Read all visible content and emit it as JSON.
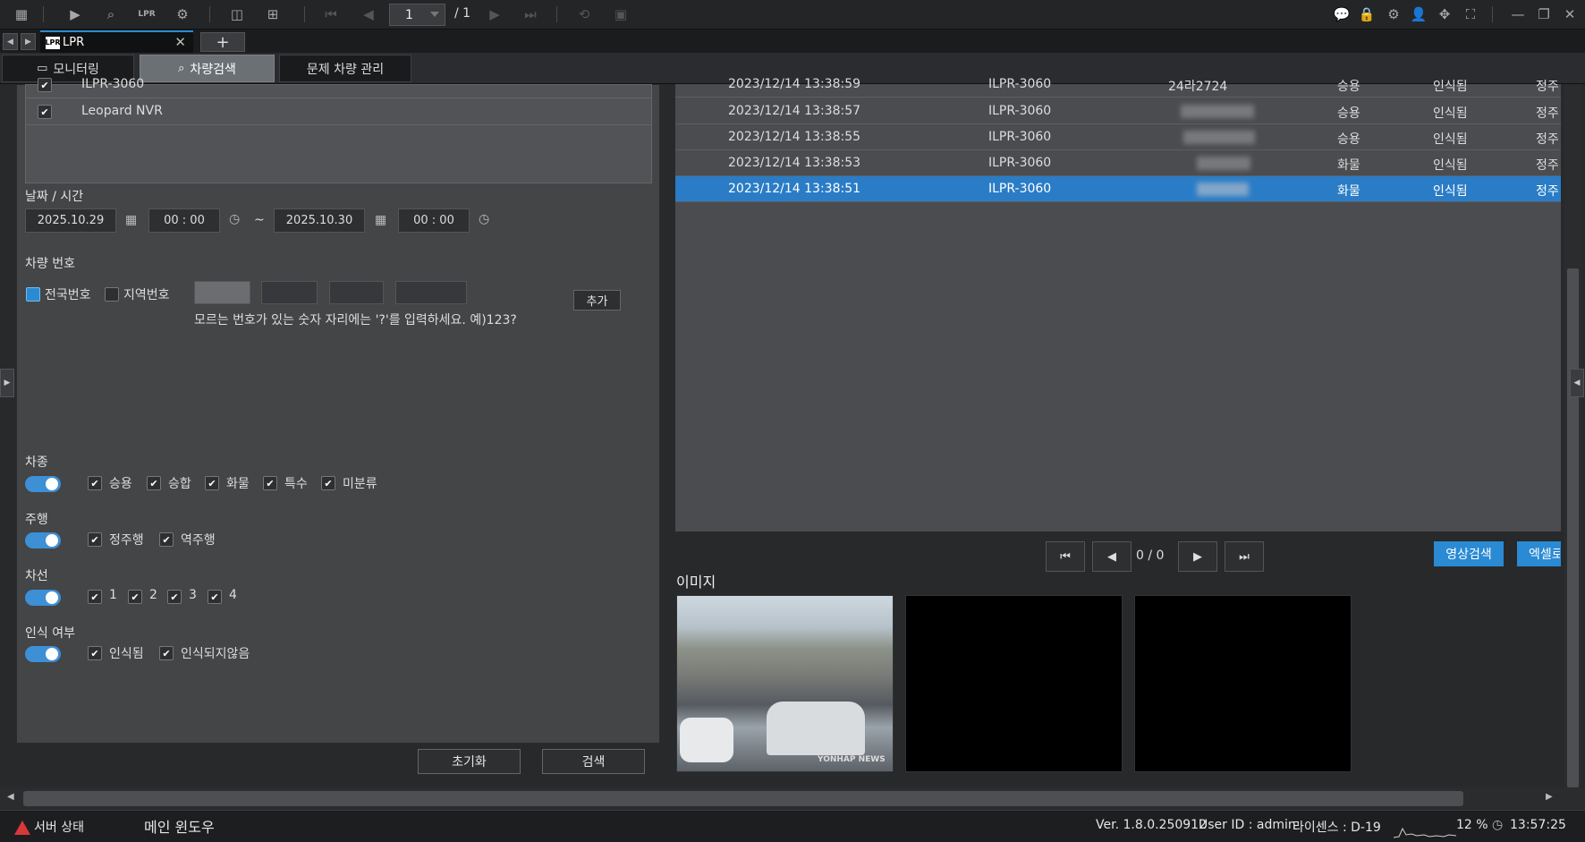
{
  "toolbar": {
    "page_current": "1",
    "page_total": "/ 1"
  },
  "tabs": {
    "main_tab_label": "LPR",
    "main_tab_logo": "LPR",
    "add_tab": "+"
  },
  "subtabs": [
    {
      "label": "모니터링",
      "active": false
    },
    {
      "label": "차량검색",
      "active": true
    },
    {
      "label": "문제 차량 관리",
      "active": false
    }
  ],
  "devices": [
    {
      "name": "ILPR-3060",
      "checked": true
    },
    {
      "name": "Leopard NVR",
      "checked": true
    }
  ],
  "datetime": {
    "label": "날짜 / 시간",
    "start_date": "2025.10.29",
    "start_time": "00 : 00",
    "separator": "~",
    "end_date": "2025.10.30",
    "end_time": "00 : 00"
  },
  "plate": {
    "label": "차량 번호",
    "national_label": "전국번호",
    "regional_label": "지역번호",
    "add_button": "추가",
    "hint": "모르는 번호가 있는 숫자 자리에는 '?'를 입력하세요. 예)123?"
  },
  "vehicle_type": {
    "label": "차종",
    "options": [
      "승용",
      "승합",
      "화물",
      "특수",
      "미분류"
    ]
  },
  "direction": {
    "label": "주행",
    "options": [
      "정주행",
      "역주행"
    ]
  },
  "lane": {
    "label": "차선",
    "options": [
      "1",
      "2",
      "3",
      "4"
    ]
  },
  "recognition": {
    "label": "인식 여부",
    "options": [
      "인식됨",
      "인식되지않음"
    ]
  },
  "actions": {
    "reset": "초기화",
    "search": "검색"
  },
  "results": [
    {
      "time": "2023/12/14 13:38:59",
      "device": "ILPR-3060",
      "plate": "24라2724",
      "type": "승용",
      "status": "인식됨",
      "dir": "정주"
    },
    {
      "time": "2023/12/14 13:38:57",
      "device": "ILPR-3060",
      "plate": "",
      "type": "승용",
      "status": "인식됨",
      "dir": "정주"
    },
    {
      "time": "2023/12/14 13:38:55",
      "device": "ILPR-3060",
      "plate": "",
      "type": "승용",
      "status": "인식됨",
      "dir": "정주"
    },
    {
      "time": "2023/12/14 13:38:53",
      "device": "ILPR-3060",
      "plate": "",
      "type": "화물",
      "status": "인식됨",
      "dir": "정주"
    },
    {
      "time": "2023/12/14 13:38:51",
      "device": "ILPR-3060",
      "plate": "",
      "type": "화물",
      "status": "인식됨",
      "dir": "정주",
      "selected": true
    }
  ],
  "pagination": {
    "text": "0 / 0"
  },
  "right_buttons": {
    "video_search": "영상검색",
    "excel": "엑셀로"
  },
  "images": {
    "label": "이미지",
    "watermark": "YONHAP NEWS"
  },
  "status": {
    "server_status": "서버 상태",
    "window": "메인 윈도우",
    "version": "Ver. 1.8.0.250912",
    "user": "User ID : admin",
    "license": "라이센스 : D-19",
    "cpu": "12 %",
    "clock": "13:57:25"
  },
  "colors": {
    "accent": "#2a8ad4",
    "selected_row": "#2a7cc6",
    "warning": "#d93838"
  }
}
